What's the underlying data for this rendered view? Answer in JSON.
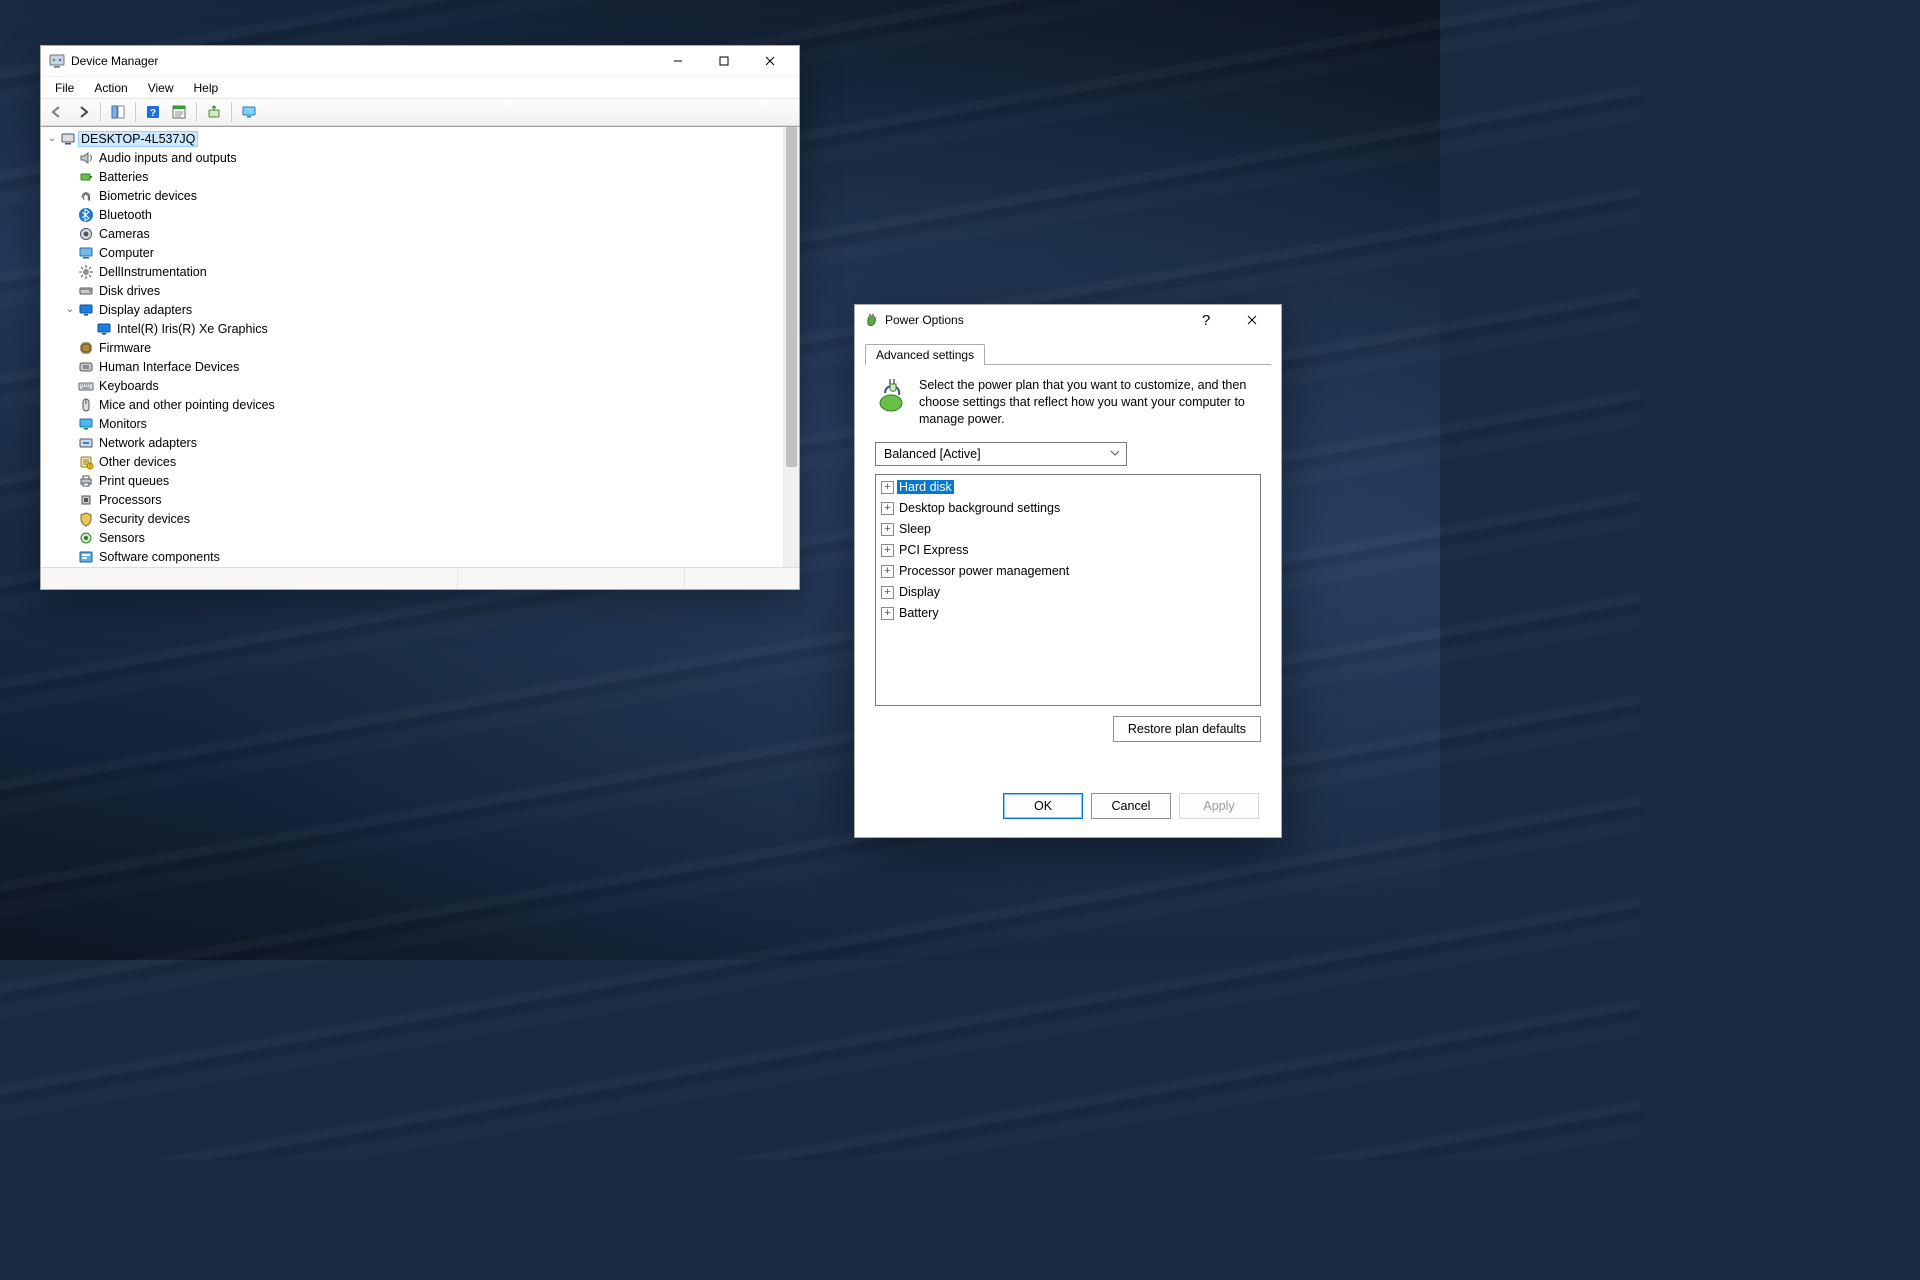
{
  "devmgr": {
    "title": "Device Manager",
    "menus": [
      "File",
      "Action",
      "View",
      "Help"
    ],
    "root": {
      "label": "DESKTOP-4L537JQ",
      "expanded": true,
      "children": [
        {
          "label": "Audio inputs and outputs",
          "icon": "speaker",
          "expanded": false
        },
        {
          "label": "Batteries",
          "icon": "battery",
          "expanded": false
        },
        {
          "label": "Biometric devices",
          "icon": "fingerprint",
          "expanded": false
        },
        {
          "label": "Bluetooth",
          "icon": "bluetooth",
          "expanded": false
        },
        {
          "label": "Cameras",
          "icon": "camera",
          "expanded": false
        },
        {
          "label": "Computer",
          "icon": "computer",
          "expanded": false
        },
        {
          "label": "DellInstrumentation",
          "icon": "gear",
          "expanded": false
        },
        {
          "label": "Disk drives",
          "icon": "disk",
          "expanded": false
        },
        {
          "label": "Display adapters",
          "icon": "display",
          "expanded": true,
          "children": [
            {
              "label": "Intel(R) Iris(R) Xe Graphics",
              "icon": "display"
            }
          ]
        },
        {
          "label": "Firmware",
          "icon": "chip",
          "expanded": false
        },
        {
          "label": "Human Interface Devices",
          "icon": "hid",
          "expanded": false
        },
        {
          "label": "Keyboards",
          "icon": "keyboard",
          "expanded": false
        },
        {
          "label": "Mice and other pointing devices",
          "icon": "mouse",
          "expanded": false
        },
        {
          "label": "Monitors",
          "icon": "monitor",
          "expanded": false
        },
        {
          "label": "Network adapters",
          "icon": "network",
          "expanded": false
        },
        {
          "label": "Other devices",
          "icon": "other",
          "expanded": false
        },
        {
          "label": "Print queues",
          "icon": "printer",
          "expanded": false
        },
        {
          "label": "Processors",
          "icon": "cpu",
          "expanded": false
        },
        {
          "label": "Security devices",
          "icon": "shield",
          "expanded": false
        },
        {
          "label": "Sensors",
          "icon": "sensor",
          "expanded": false
        },
        {
          "label": "Software components",
          "icon": "software",
          "expanded": false
        }
      ]
    }
  },
  "power": {
    "title": "Power Options",
    "tab_label": "Advanced settings",
    "desc": "Select the power plan that you want to customize, and then choose settings that reflect how you want your computer to manage power.",
    "plan_selected": "Balanced [Active]",
    "settings": [
      {
        "label": "Hard disk",
        "selected": true
      },
      {
        "label": "Desktop background settings"
      },
      {
        "label": "Sleep"
      },
      {
        "label": "PCI Express"
      },
      {
        "label": "Processor power management"
      },
      {
        "label": "Display"
      },
      {
        "label": "Battery"
      }
    ],
    "restore_label": "Restore plan defaults",
    "buttons": {
      "ok": "OK",
      "cancel": "Cancel",
      "apply": "Apply"
    }
  }
}
